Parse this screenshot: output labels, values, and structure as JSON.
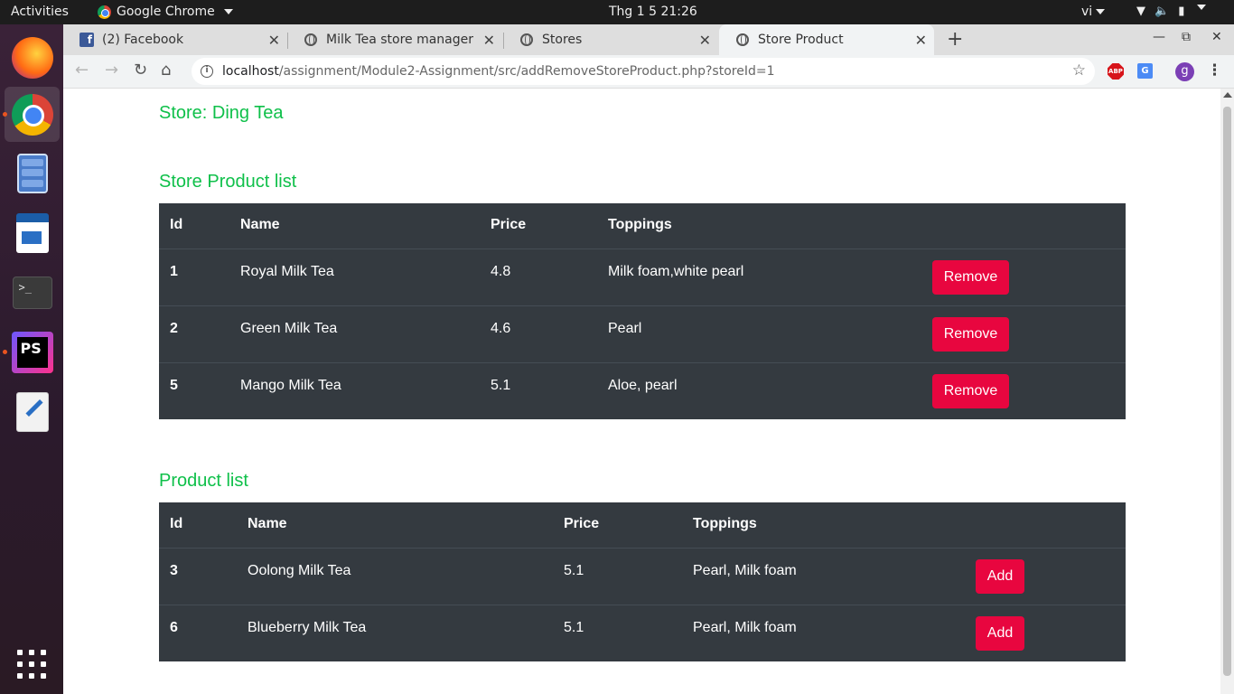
{
  "topbar": {
    "activities": "Activities",
    "app_name": "Google Chrome",
    "clock": "Thg 1 5  21:26",
    "input_lang": "vi"
  },
  "tabs": [
    {
      "title": "(2) Facebook",
      "favicon": "facebook-icon"
    },
    {
      "title": "Milk Tea store manager",
      "favicon": "globe-icon"
    },
    {
      "title": "Stores",
      "favicon": "globe-icon"
    },
    {
      "title": "Store Product",
      "favicon": "globe-icon",
      "active": true
    }
  ],
  "address_bar": {
    "host": "localhost",
    "path": "/assignment/Module2-Assignment/src/addRemoveStoreProduct.php?storeId=1"
  },
  "extensions": {
    "abp": "ABP",
    "translate": "G"
  },
  "profile_initial": "g",
  "page": {
    "store_heading": "Store: Ding Tea",
    "store_products_heading": "Store Product list",
    "products_heading": "Product list",
    "columns": {
      "id": "Id",
      "name": "Name",
      "price": "Price",
      "toppings": "Toppings"
    },
    "store_products": [
      {
        "id": "1",
        "name": "Royal Milk Tea",
        "price": "4.8",
        "toppings": "Milk foam,white pearl",
        "action": "Remove"
      },
      {
        "id": "2",
        "name": "Green Milk Tea",
        "price": "4.6",
        "toppings": "Pearl",
        "action": "Remove"
      },
      {
        "id": "5",
        "name": "Mango Milk Tea",
        "price": "5.1",
        "toppings": "Aloe, pearl",
        "action": "Remove"
      }
    ],
    "products": [
      {
        "id": "3",
        "name": "Oolong Milk Tea",
        "price": "5.1",
        "toppings": "Pearl, Milk foam",
        "action": "Add"
      },
      {
        "id": "6",
        "name": "Blueberry Milk Tea",
        "price": "5.1",
        "toppings": "Pearl, Milk foam",
        "action": "Add"
      }
    ]
  },
  "colors": {
    "heading_green": "#0fc04a",
    "table_dark": "#343a40",
    "button_red": "#e8063f"
  }
}
